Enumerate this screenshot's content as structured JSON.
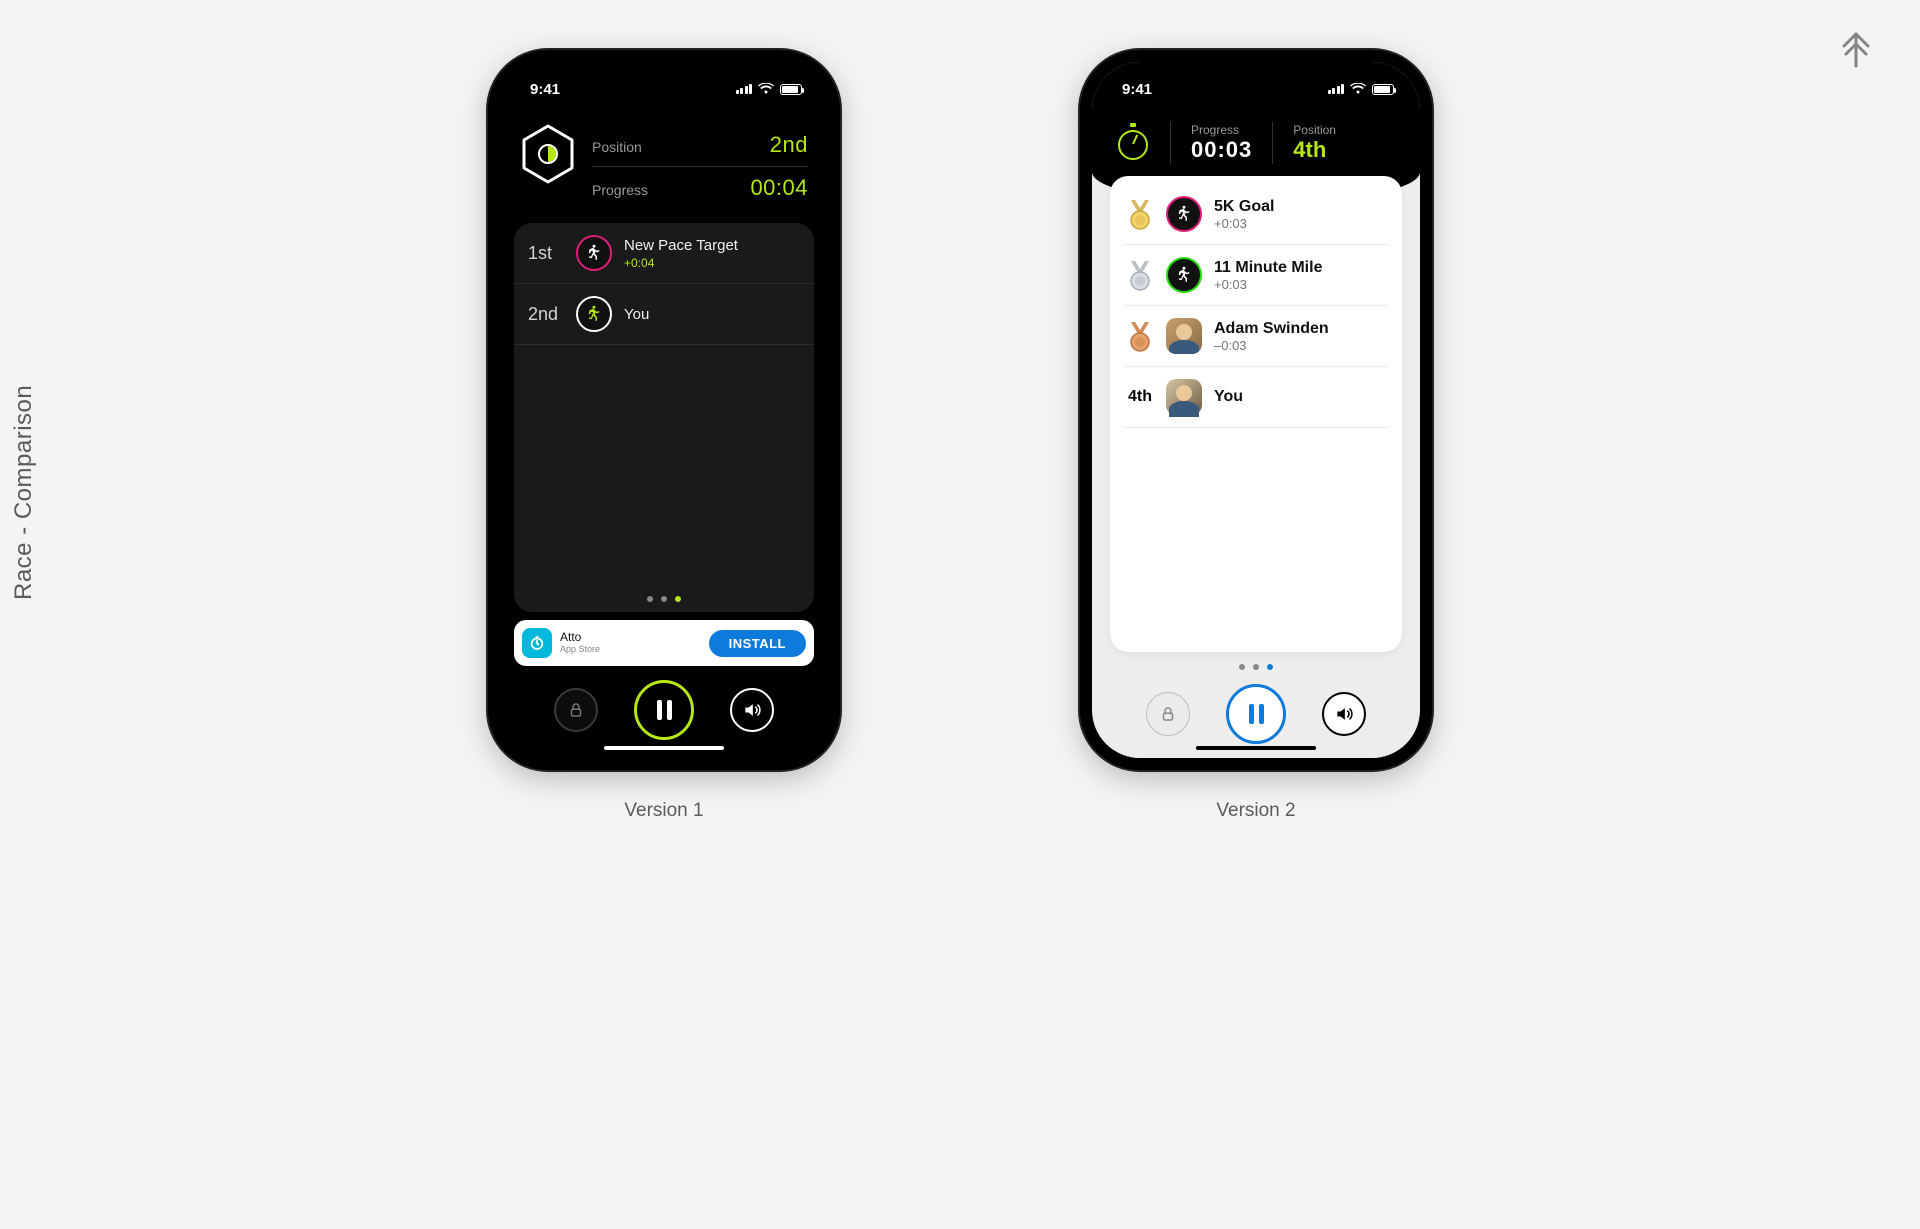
{
  "page": {
    "title": "Race - Comparison"
  },
  "captions": {
    "v1": "Version 1",
    "v2": "Version 2"
  },
  "status": {
    "time": "9:41"
  },
  "v1": {
    "header": {
      "position_label": "Position",
      "position_value": "2nd",
      "progress_label": "Progress",
      "progress_value": "00:04"
    },
    "racers": [
      {
        "rank": "1st",
        "name": "New Pace Target",
        "diff": "+0:04",
        "avatar": "target-pink"
      },
      {
        "rank": "2nd",
        "name": "You",
        "diff": "",
        "avatar": "self"
      }
    ],
    "ad": {
      "title": "Atto",
      "subtitle": "App Store",
      "cta": "INSTALL"
    }
  },
  "v2": {
    "header": {
      "progress_label": "Progress",
      "progress_value": "00:03",
      "position_label": "Position",
      "position_value": "4th"
    },
    "racers": [
      {
        "medal": "gold",
        "name": "5K Goal",
        "diff": "+0:03",
        "avatar": "target-pink"
      },
      {
        "medal": "silver",
        "name": "11 Minute Mile",
        "diff": "+0:03",
        "avatar": "target-green"
      },
      {
        "medal": "bronze",
        "name": "Adam Swinden",
        "diff": "–0:03",
        "avatar": "photo"
      },
      {
        "rank": "4th",
        "name": "You",
        "diff": "",
        "avatar": "photo-self"
      }
    ]
  }
}
